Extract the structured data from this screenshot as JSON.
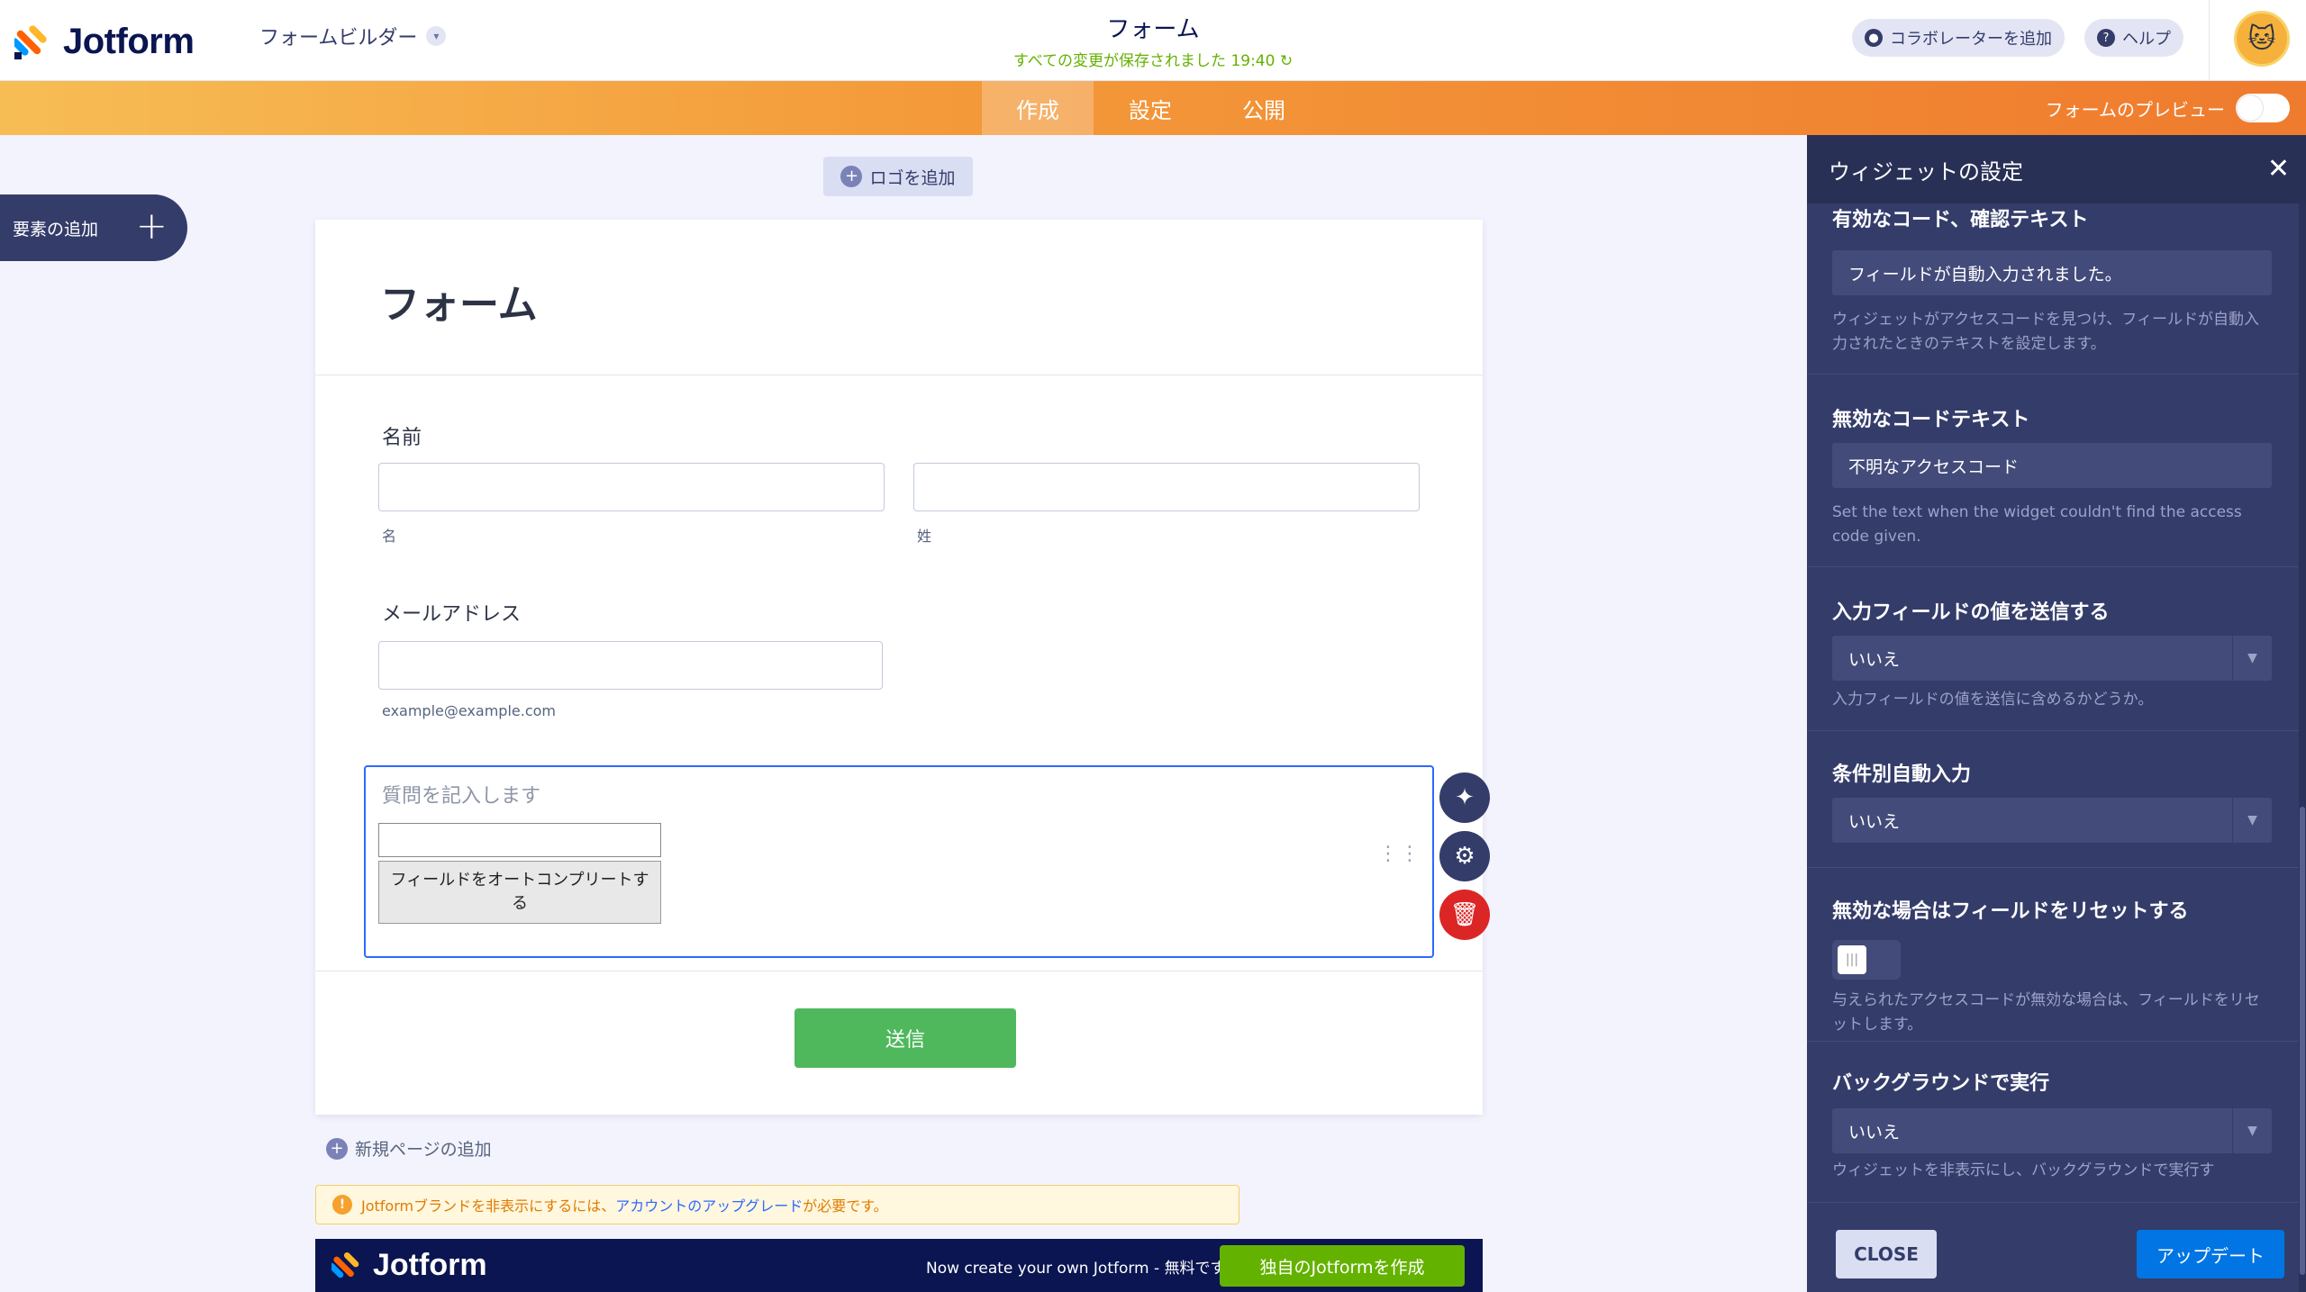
{
  "app": {
    "brand": "Jotform",
    "builder_label": "フォームビルダー"
  },
  "header": {
    "form_title": "フォーム",
    "save_status": "すべての変更が保存されました 19:40",
    "add_collaborator": "コラボレーターを追加",
    "help": "ヘルプ"
  },
  "nav": {
    "tabs": [
      {
        "label": "作成",
        "active": true
      },
      {
        "label": "設定",
        "active": false
      },
      {
        "label": "公開",
        "active": false
      }
    ],
    "preview_label": "フォームのプレビュー"
  },
  "builder": {
    "add_element": "要素の追加",
    "add_logo": "ロゴを追加",
    "form_heading": "フォーム",
    "name_label": "名前",
    "first_sub": "名",
    "last_sub": "姓",
    "email_label": "メールアドレス",
    "email_sub": "example@example.com",
    "widget_question_placeholder": "質問を記入します",
    "widget_button": "フィールドをオートコンプリートする",
    "submit": "送信",
    "add_page": "新規ページの追加",
    "brand_warning_text": "Jotformブランドを非表示にするには、",
    "brand_warning_link": "アカウントのアップグレード",
    "brand_warning_end": "が必要です。",
    "footer_brand": "Jotform",
    "footer_text": "Now create your own Jotform - 無料です",
    "footer_button": "独自のJotformを作成"
  },
  "panel": {
    "title": "ウィジェットの設定",
    "sections": [
      {
        "title": "有効なコード、確認テキスト",
        "value": "フィールドが自動入力されました。",
        "desc": "ウィジェットがアクセスコードを見つけ、フィールドが自動入力されたときのテキストを設定します。"
      },
      {
        "title": "無効なコードテキスト",
        "value": "不明なアクセスコード",
        "desc": "Set the text when the widget couldn't find the access code given."
      },
      {
        "title": "入力フィールドの値を送信する",
        "value": "いいえ",
        "desc": "入力フィールドの値を送信に含めるかどうか。"
      },
      {
        "title": "条件別自動入力",
        "value": "いいえ",
        "desc": ""
      },
      {
        "title": "無効な場合はフィールドをリセットする",
        "value": "",
        "desc": "与えられたアクセスコードが無効な場合は、フィールドをリセットします。"
      },
      {
        "title": "バックグラウンドで実行",
        "value": "いいえ",
        "desc": "ウィジェットを非表示にし、バックグラウンドで実行す"
      }
    ],
    "close": "CLOSE",
    "update": "アップデート"
  }
}
